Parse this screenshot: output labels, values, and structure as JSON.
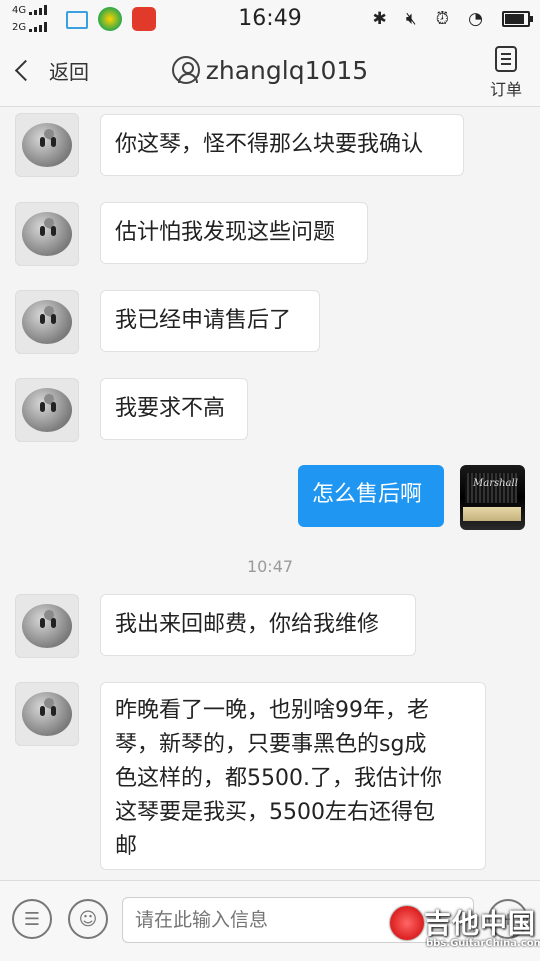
{
  "status_bar": {
    "signal_1": "4G",
    "signal_2": "2G",
    "time": "16:49",
    "icons": [
      "photo-icon",
      "app-icon-green",
      "app-icon-red",
      "bluetooth-icon",
      "mute-icon",
      "alarm-icon",
      "wifi-icon",
      "battery-icon"
    ]
  },
  "header": {
    "back_label": "返回",
    "title": "zhanglq1015",
    "orders_label": "订单"
  },
  "messages": [
    {
      "side": "in",
      "text": "你这琴，怪不得那么块要我确认"
    },
    {
      "side": "in",
      "text": "估计怕我发现这些问题"
    },
    {
      "side": "in",
      "text": "我已经申请售后了"
    },
    {
      "side": "in",
      "text": "我要求不高"
    },
    {
      "side": "out",
      "text": "怎么售后啊"
    },
    {
      "type": "timestamp",
      "text": "10:47"
    },
    {
      "side": "in",
      "text": "我出来回邮费，你给我维修"
    },
    {
      "side": "in",
      "lines": [
        "昨晚看了一晚，也别啥99年，老",
        "琴，新琴的，只要事黑色的sg成",
        "色这样的，都5500.了，我估计你",
        "这琴要是我买，5500左右还得包",
        "邮"
      ]
    }
  ],
  "photo_avatar_text": "Marshall",
  "input": {
    "placeholder": "请在此输入信息"
  },
  "watermark": {
    "text": "吉他中国",
    "sub": "bbs.GuitarChina.com"
  },
  "colors": {
    "outgoing_bubble": "#1f96f2",
    "incoming_bubble": "#ffffff",
    "background": "#f4f4f4"
  }
}
